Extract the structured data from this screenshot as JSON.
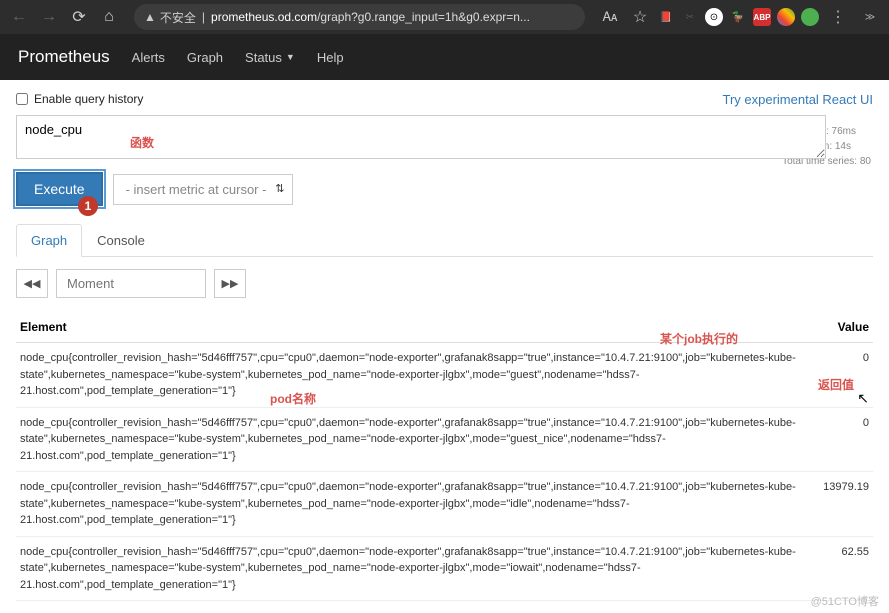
{
  "browser": {
    "insecure": "不安全",
    "domain": "prometheus.od.com",
    "path": "/graph?g0.range_input=1h&g0.expr=n..."
  },
  "nav": {
    "brand": "Prometheus",
    "alerts": "Alerts",
    "graph": "Graph",
    "status": "Status",
    "help": "Help"
  },
  "ui": {
    "enable_history": "Enable query history",
    "react_link": "Try experimental React UI",
    "query": "node_cpu",
    "execute": "Execute",
    "metric_placeholder": "- insert metric at cursor -",
    "tab_graph": "Graph",
    "tab_console": "Console",
    "moment_placeholder": "Moment",
    "badge": "1"
  },
  "info": {
    "load": "Load time: 76ms",
    "res": "Resolution: 14s",
    "series": "Total time series: 80"
  },
  "table": {
    "col_element": "Element",
    "col_value": "Value",
    "rows": [
      {
        "element": "node_cpu{controller_revision_hash=\"5d46fff757\",cpu=\"cpu0\",daemon=\"node-exporter\",grafanak8sapp=\"true\",instance=\"10.4.7.21:9100\",job=\"kubernetes-kube-state\",kubernetes_namespace=\"kube-system\",kubernetes_pod_name=\"node-exporter-jlgbx\",mode=\"guest\",nodename=\"hdss7-21.host.com\",pod_template_generation=\"1\"}",
        "value": "0"
      },
      {
        "element": "node_cpu{controller_revision_hash=\"5d46fff757\",cpu=\"cpu0\",daemon=\"node-exporter\",grafanak8sapp=\"true\",instance=\"10.4.7.21:9100\",job=\"kubernetes-kube-state\",kubernetes_namespace=\"kube-system\",kubernetes_pod_name=\"node-exporter-jlgbx\",mode=\"guest_nice\",nodename=\"hdss7-21.host.com\",pod_template_generation=\"1\"}",
        "value": "0"
      },
      {
        "element": "node_cpu{controller_revision_hash=\"5d46fff757\",cpu=\"cpu0\",daemon=\"node-exporter\",grafanak8sapp=\"true\",instance=\"10.4.7.21:9100\",job=\"kubernetes-kube-state\",kubernetes_namespace=\"kube-system\",kubernetes_pod_name=\"node-exporter-jlgbx\",mode=\"idle\",nodename=\"hdss7-21.host.com\",pod_template_generation=\"1\"}",
        "value": "13979.19"
      },
      {
        "element": "node_cpu{controller_revision_hash=\"5d46fff757\",cpu=\"cpu0\",daemon=\"node-exporter\",grafanak8sapp=\"true\",instance=\"10.4.7.21:9100\",job=\"kubernetes-kube-state\",kubernetes_namespace=\"kube-system\",kubernetes_pod_name=\"node-exporter-jlgbx\",mode=\"iowait\",nodename=\"hdss7-21.host.com\",pod_template_generation=\"1\"}",
        "value": "62.55"
      }
    ]
  },
  "annotations": {
    "func": "函数",
    "job": "某个job执行的",
    "pod": "pod名称",
    "return": "返回值"
  },
  "watermark": "@51CTO博客"
}
